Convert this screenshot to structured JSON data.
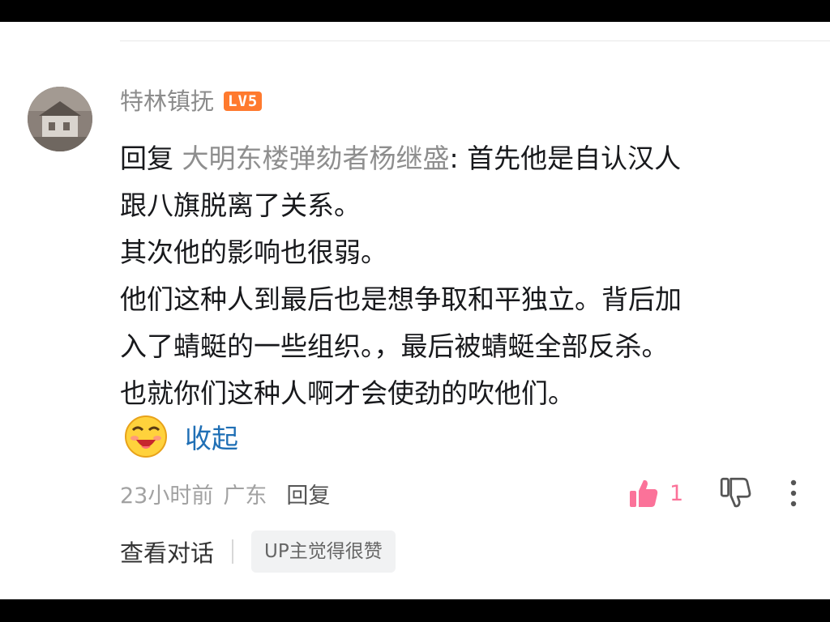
{
  "comment": {
    "author": "特林镇抚",
    "level_badge": "LV5",
    "content": {
      "reply_prefix": "回复 ",
      "reply_target": "大明东楼弹劾者杨继盛",
      "reply_colon": ": ",
      "first_line_text": "首先他是自认汉人",
      "lines": [
        "跟八旗脱离了关系。",
        "其次他的影响也很弱。",
        "他们这种人到最后也是想争取和平独立。背后加",
        "入了蜻蜓的一些组织。，最后被蜻蜓全部反杀。",
        "也就你们这种人啊才会使劲的吹他们。"
      ]
    },
    "collapse_label": "收起",
    "meta": {
      "time": "23小时前",
      "location": "广东",
      "reply_label": "回复"
    },
    "likes": "1",
    "footer": {
      "view_conversation": "查看对话",
      "up_badge": "UP主觉得很赞"
    }
  },
  "colors": {
    "level_badge": "#ff7a2e",
    "like_pink": "#fb7299",
    "link_blue": "#1f6fb5"
  },
  "icons": [
    "avatar-image",
    "laughing-emoji-icon",
    "thumbs-up-icon",
    "thumbs-down-icon",
    "more-vertical-icon"
  ]
}
